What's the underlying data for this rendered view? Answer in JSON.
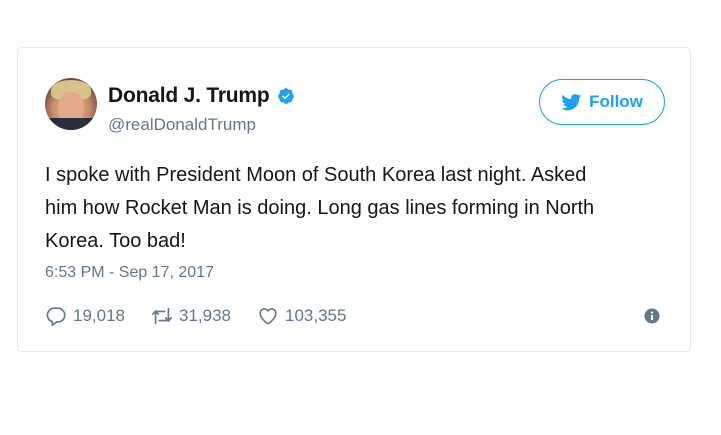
{
  "tweet": {
    "author": {
      "name": "Donald J. Trump",
      "handle": "@realDonaldTrump",
      "verified": true
    },
    "follow_label": "Follow",
    "text": "I spoke with President Moon of South Korea last night. Asked\nhim how Rocket Man is doing. Long gas lines forming in North\nKorea. Too bad!",
    "timestamp": "6:53 PM - Sep 17, 2017",
    "stats": {
      "replies": "19,018",
      "retweets": "31,938",
      "likes": "103,355"
    }
  },
  "icons": {
    "verified": "verified-badge-icon",
    "follow": "twitter-bird-icon",
    "reply": "reply-bubble-icon",
    "retweet": "retweet-icon",
    "like": "heart-icon",
    "info": "info-icon"
  },
  "colors": {
    "accent": "#1da1f2",
    "text": "#14171a",
    "secondary": "#657786",
    "border": "#e1e8ed"
  }
}
